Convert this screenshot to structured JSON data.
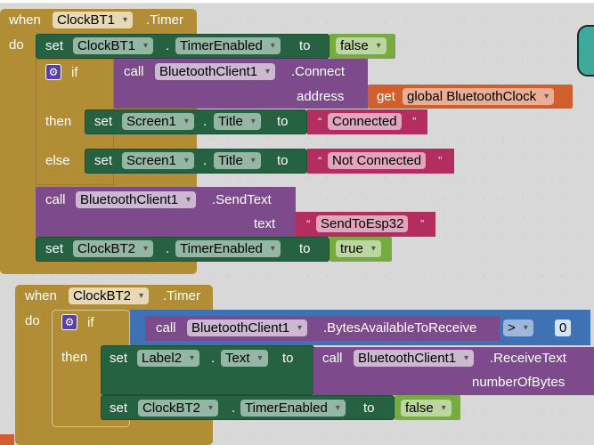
{
  "workspace": {
    "name": "blocks-editor"
  },
  "colors": {
    "event": "#b18e35",
    "setter": "#266141",
    "procedure": "#7d4b8c",
    "text": "#b32d5e",
    "logic": "#77ab41",
    "variable": "#d05f2d",
    "math": "#3f71b5"
  },
  "event1": {
    "when": "when",
    "component": "ClockBT1",
    "event": ".Timer",
    "do": "do",
    "set1": {
      "set": "set",
      "component": "ClockBT1",
      "dot": ".",
      "property": "TimerEnabled",
      "to": "to",
      "value": "false"
    },
    "if": {
      "if": "if",
      "call": "call",
      "component": "BluetoothClient1",
      "method": ".Connect",
      "param_label": "address",
      "get": "get",
      "var": "global BluetoothClock",
      "then": "then",
      "then_set": {
        "set": "set",
        "component": "Screen1",
        "dot": ".",
        "property": "Title",
        "to": "to",
        "value": "Connected"
      },
      "else": "else",
      "else_set": {
        "set": "set",
        "component": "Screen1",
        "dot": ".",
        "property": "Title",
        "to": "to",
        "value": "Not Connected"
      }
    },
    "send": {
      "call": "call",
      "component": "BluetoothClient1",
      "method": ".SendText",
      "param_label": "text",
      "value": "SendToEsp32"
    },
    "set2": {
      "set": "set",
      "component": "ClockBT2",
      "dot": ".",
      "property": "TimerEnabled",
      "to": "to",
      "value": "true"
    }
  },
  "event2": {
    "when": "when",
    "component": "ClockBT2",
    "event": ".Timer",
    "do": "do",
    "if": {
      "if": "if",
      "call": "call",
      "component": "BluetoothClient1",
      "method": ".BytesAvailableToReceive",
      "operator": ">",
      "number": "0",
      "then": "then",
      "then_set": {
        "set": "set",
        "component": "Label2",
        "dot": ".",
        "property": "Text",
        "to": "to",
        "call": "call",
        "call_component": "BluetoothClient1",
        "call_method": ".ReceiveText",
        "param_label": "numberOfBytes"
      },
      "set2": {
        "set": "set",
        "component": "ClockBT2",
        "dot": ".",
        "property": "TimerEnabled",
        "to": "to",
        "value": "false"
      }
    }
  },
  "open_quote": "“",
  "close_quote": "”"
}
